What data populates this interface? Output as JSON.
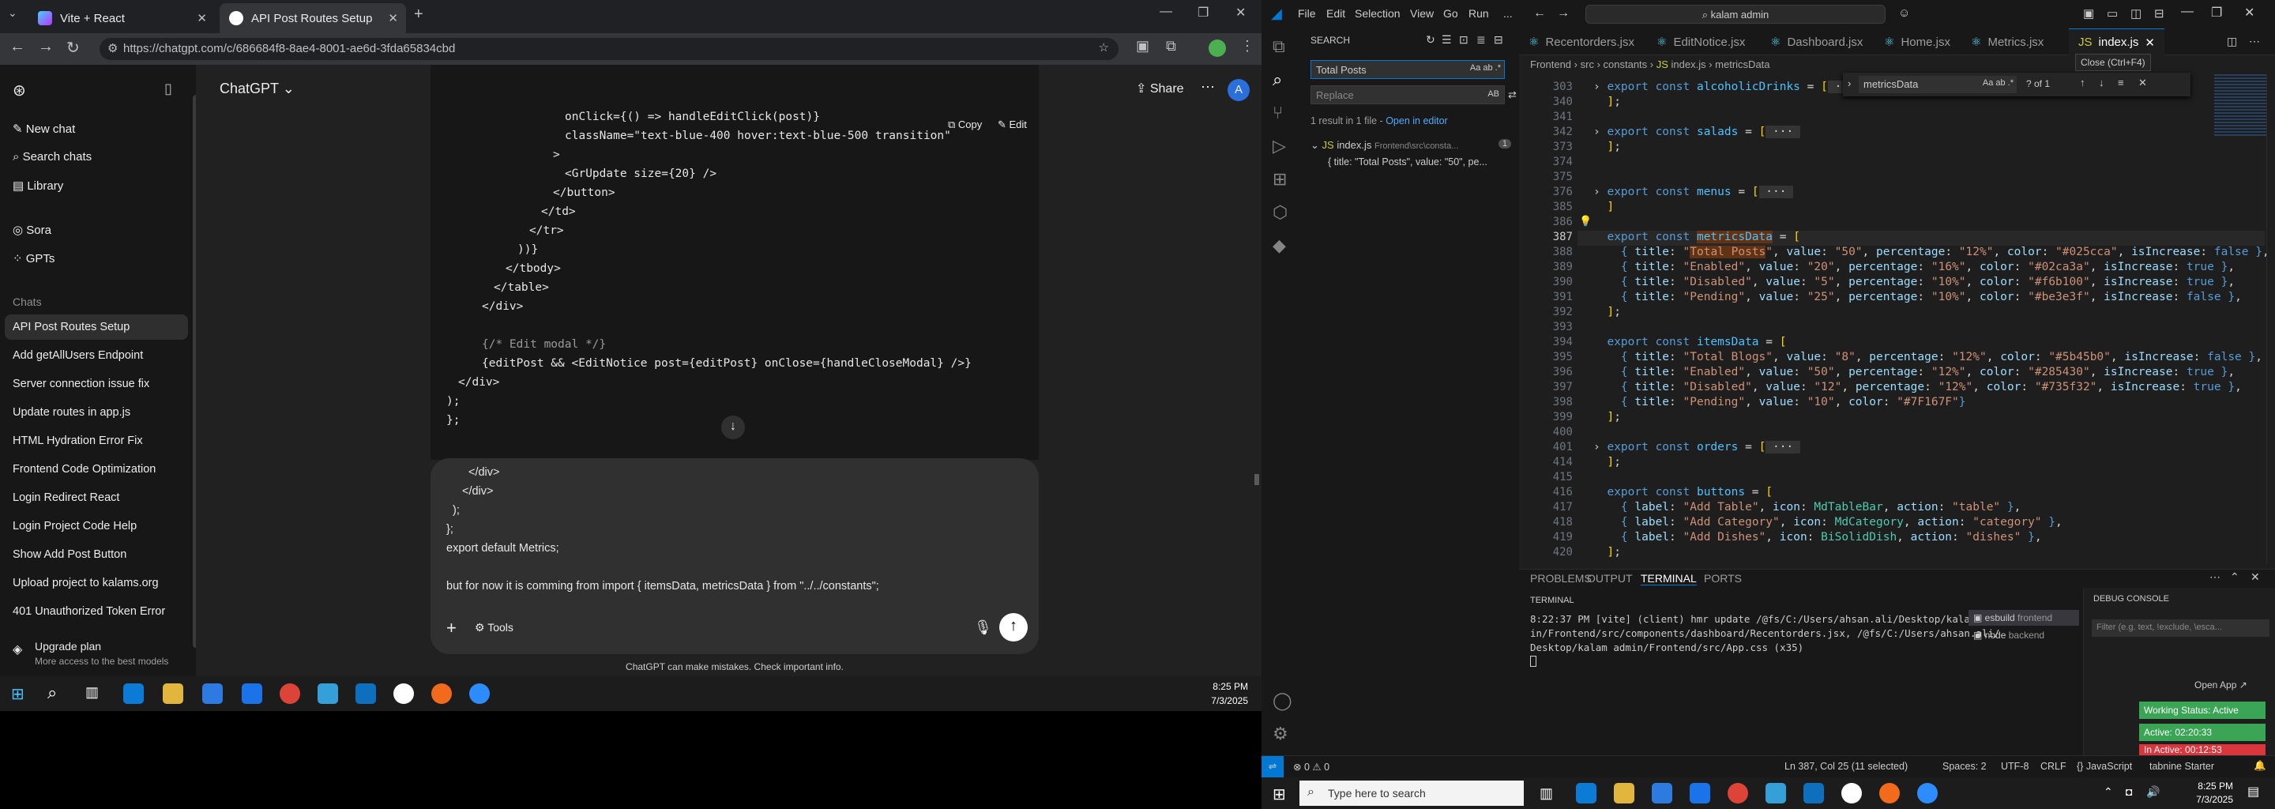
{
  "browser": {
    "tabs": [
      {
        "label": "Vite + React"
      },
      {
        "label": "API Post Routes Setup"
      }
    ],
    "new_tab": "+",
    "url": "https://chatgpt.com/c/686684f8-8ae4-8001-ae6d-3fda65834cbd"
  },
  "chatgpt": {
    "new_chat": "New chat",
    "search_chats": "Search chats",
    "library": "Library",
    "sora": "Sora",
    "gpts": "GPTs",
    "chats_header": "Chats",
    "chats": [
      "API Post Routes Setup",
      "Add getAllUsers Endpoint",
      "Server connection issue fix",
      "Update routes in app.js",
      "HTML Hydration Error Fix",
      "Frontend Code Optimization",
      "Login Redirect React",
      "Login Project Code Help",
      "Show Add Post Button",
      "Upload project to kalams.org",
      "401 Unauthorized Token Error"
    ],
    "upgrade_title": "Upgrade plan",
    "upgrade_sub": "More access to the best models",
    "model": "ChatGPT",
    "share": "Share",
    "avatar": "A",
    "copy": "Copy",
    "edit": "Edit",
    "code_lines": [
      "onClick={() => handleEditClick(post)}",
      "className=\"text-blue-400 hover:text-blue-500 transition\"",
      ">",
      "<GrUpdate size={20} />",
      "</button>",
      "</td>",
      "</tr>",
      "))}",
      "</tbody>",
      "</table>",
      "</div>",
      "",
      "{/* Edit modal */}",
      "{editPost && <EditNotice post={editPost} onClose={handleCloseModal} />}",
      "</div>",
      ");",
      "};"
    ],
    "composer_lines": [
      "</div>",
      "</div>",
      ");",
      "};",
      "export default Metrics;",
      "",
      "but for now it is comming from import { itemsData, metricsData } from \"../../constants\";"
    ],
    "tools": "Tools",
    "disclaimer": "ChatGPT can make mistakes. Check important info."
  },
  "taskbar_left": {
    "time": "8:25 PM",
    "date": "7/3/2025"
  },
  "vscode": {
    "menu": [
      "File",
      "Edit",
      "Selection",
      "View",
      "Go",
      "Run",
      "..."
    ],
    "search_box": "kalam admin",
    "search_panel": {
      "title": "SEARCH",
      "query": "Total Posts",
      "replace": "Replace",
      "replace_btn": "AB",
      "result_summary": "1 result in 1 file -",
      "open_editor": "Open in editor",
      "file": "index.js",
      "file_path": "Frontend\\src\\consta...",
      "count": "1",
      "match": "{ title: \"Total Posts\", value: \"50\", pe..."
    },
    "tabs": [
      "Recentorders.jsx",
      "EditNotice.jsx",
      "Dashboard.jsx",
      "Home.jsx",
      "Metrics.jsx",
      "index.js"
    ],
    "tooltip": "Close (Ctrl+F4)",
    "breadcrumb": [
      "Frontend",
      "src",
      "constants",
      "index.js",
      "metricsData"
    ],
    "find": {
      "query": "metricsData",
      "count": "? of 1"
    },
    "line_numbers": [
      "303",
      "340",
      "341",
      "342",
      "373",
      "374",
      "375",
      "376",
      "385",
      "386",
      "387",
      "388",
      "389",
      "390",
      "391",
      "392",
      "393",
      "394",
      "395",
      "396",
      "397",
      "398",
      "399",
      "400",
      "401",
      "414",
      "415",
      "416",
      "417",
      "418",
      "419",
      "420"
    ],
    "panel_tabs": [
      "PROBLEMS",
      "OUTPUT",
      "TERMINAL",
      "PORTS"
    ],
    "terminal_title": "TERMINAL",
    "terminal_lines": [
      "8:22:37 PM [vite] (client) hmr update /@fs/C:/Users/ahsan.ali/Desktop/kalam adm",
      "in/Frontend/src/components/dashboard/Recentorders.jsx, /@fs/C:/Users/ahsan.ali/",
      "Desktop/kalam admin/Frontend/src/App.css (x35)"
    ],
    "terminals": [
      {
        "name": "esbuild",
        "sub": "frontend"
      },
      {
        "name": "node",
        "sub": "backend"
      }
    ],
    "debug_title": "DEBUG CONSOLE",
    "debug_filter": "Filter (e.g. text, !exclude, \\esca...",
    "open_app": "Open App ↗",
    "working_status": "Working Status: Active",
    "active_time": "Active: 02:20:33",
    "inactive_time": "In Active: 00:12:53",
    "status": {
      "errors": "0",
      "warnings": "0",
      "position": "Ln 387, Col 25 (11 selected)",
      "spaces": "Spaces: 2",
      "encoding": "UTF-8",
      "eol": "CRLF",
      "language": "{} JavaScript",
      "tabnine": "tabnine Starter"
    }
  },
  "taskbar_right": {
    "search_placeholder": "Type here to search",
    "time": "8:25 PM",
    "date": "7/3/2025"
  }
}
